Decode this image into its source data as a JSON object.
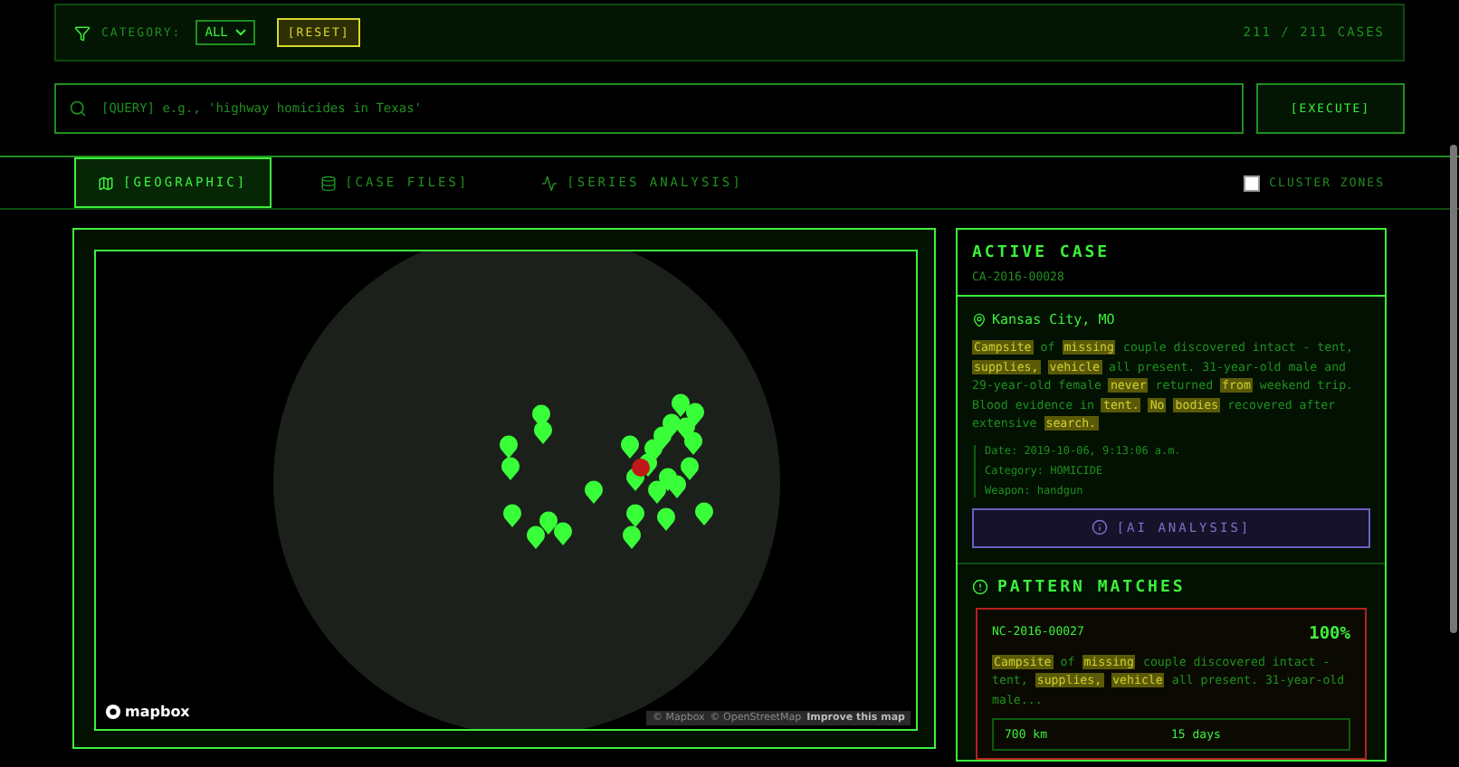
{
  "filter_bar": {
    "label": "CATEGORY:",
    "category": "ALL",
    "reset": "[RESET]",
    "count": "211 / 211 CASES"
  },
  "search": {
    "placeholder": "[QUERY] e.g., 'highway homicides in Texas'",
    "button": "[EXECUTE]"
  },
  "tabs": [
    {
      "label": "[GEOGRAPHIC]",
      "selected": true
    },
    {
      "label": "[CASE FILES]",
      "selected": false
    },
    {
      "label": "[SERIES ANALYSIS]",
      "selected": false
    }
  ],
  "cluster_toggle": {
    "label": "CLUSTER ZONES",
    "checked": false
  },
  "map": {
    "logo": "mapbox",
    "attribution": [
      "© Mapbox",
      "© OpenStreetMap"
    ],
    "improve_link": "Improve this map"
  },
  "active_case": {
    "title": "ACTIVE CASE",
    "case_id": "CA-2016-00028",
    "location": "Kansas City, MO",
    "description": [
      {
        "text": "Campsite",
        "highlight": true
      },
      {
        "text": "of",
        "highlight": false
      },
      {
        "text": "missing",
        "highlight": true
      },
      {
        "text": "couple discovered intact - tent,",
        "highlight": false
      },
      {
        "text": "supplies,",
        "highlight": true
      },
      {
        "text": "vehicle",
        "highlight": true
      },
      {
        "text": "all present. 31-year-old male and 29-year-old female",
        "highlight": false
      },
      {
        "text": "never",
        "highlight": true
      },
      {
        "text": "returned",
        "highlight": false
      },
      {
        "text": "from",
        "highlight": true
      },
      {
        "text": "weekend trip. Blood evidence in",
        "highlight": false
      },
      {
        "text": "tent.",
        "highlight": true
      },
      {
        "text": "No",
        "highlight": true
      },
      {
        "text": "bodies",
        "highlight": true
      },
      {
        "text": "recovered after extensive",
        "highlight": false
      },
      {
        "text": "search.",
        "highlight": true
      }
    ],
    "details": [
      {
        "label": "Date:",
        "value": "2019-10-06, 9:13:06 a.m."
      },
      {
        "label": "Category:",
        "value": "HOMICIDE"
      },
      {
        "label": "Weapon:",
        "value": "handgun"
      }
    ],
    "ai_button": "[AI ANALYSIS]"
  },
  "pattern_matches": {
    "title": "PATTERN MATCHES",
    "matches": [
      {
        "case_id": "NC-2016-00027",
        "score": "100%",
        "description": [
          {
            "text": "Campsite",
            "highlight": true
          },
          {
            "text": "of",
            "highlight": false
          },
          {
            "text": "missing",
            "highlight": true
          },
          {
            "text": "couple discovered intact - tent,",
            "highlight": false
          },
          {
            "text": "supplies,",
            "highlight": true
          },
          {
            "text": "vehicle",
            "highlight": true
          },
          {
            "text": "all present. 31-year-old male...",
            "highlight": false
          }
        ],
        "stats": [
          "700 km",
          "15 days"
        ]
      }
    ]
  }
}
